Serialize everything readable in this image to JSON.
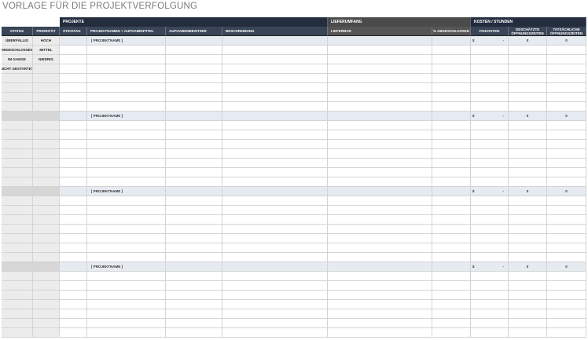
{
  "title": "VORLAGE FÜR DIE PROJEKTVERFOLGUNG",
  "groups": {
    "projekte": "PROJEKTE",
    "lieferumfang": "LIEFERUMFANG",
    "kosten": "KOSTEN / STUNDEN"
  },
  "columns": {
    "status": "STATUS",
    "prioritaet": "PRIORITÄT",
    "stichtag": "STICHTAG",
    "projektnamen": "PROJEKTNAMEN + AUFGABENTITEL",
    "aufgabenbesitzer": "AUFGABENBESITZER",
    "beschreibung": "BESCHREIBUNG",
    "lieferbar": "LIEFERBAR",
    "abgeschlossen": "% ABGESCHLOSSEN",
    "fixkosten": "FIXKOSTEN",
    "geschaetzte": "GESCHÄTZTE ÖFFNUNGSZEITEN",
    "tatsaechliche": "TATSÄCHLICHE ÖFFNUNGSZEITEN"
  },
  "legend": {
    "status": [
      "ÜBERFÄLLIG",
      "ABGESCHLOSSEN",
      "IM GANGE",
      "NICHT GESTARTET"
    ],
    "priority": [
      "HOCH",
      "MITTEL",
      "NIEDRIG"
    ]
  },
  "projects": [
    {
      "name": "[ PROJEKTNAME ]",
      "currency": "$",
      "fixkosten": "-",
      "geschaetzt": "0",
      "tatsaechlich": "0"
    },
    {
      "name": "[ PROJEKTNAME ]",
      "currency": "$",
      "fixkosten": "-",
      "geschaetzt": "0",
      "tatsaechlich": "0"
    },
    {
      "name": "[ PROJEKTNAME ]",
      "currency": "$",
      "fixkosten": "-",
      "geschaetzt": "0",
      "tatsaechlich": "0"
    },
    {
      "name": "[ PROJEKTNAME ]",
      "currency": "$",
      "fixkosten": "-",
      "geschaetzt": "0",
      "tatsaechlich": "0"
    }
  ]
}
